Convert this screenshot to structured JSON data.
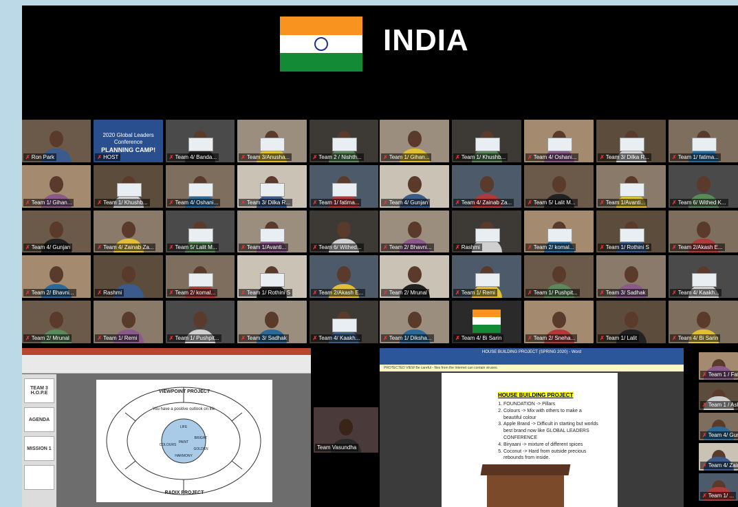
{
  "header": {
    "title": "INDIA"
  },
  "colors": {
    "saffron": "#f7931e",
    "green": "#138a36",
    "chakra": "#1c2f8a",
    "zoom_bg": "#000000"
  },
  "host_slide": {
    "line1": "2020 Global Leaders Conference",
    "line2": "PLANNING CAMP!"
  },
  "left_grid": [
    {
      "label": "Ron Park",
      "type": "person"
    },
    {
      "label": "HOST",
      "type": "host"
    },
    {
      "label": "Team 4/ Banda...",
      "type": "card"
    },
    {
      "label": "Team 3/Anusha...",
      "type": "card"
    },
    {
      "label": "Team 2 / Nishth...",
      "type": "card"
    },
    {
      "label": "Team 1/ Gihan...",
      "type": "person"
    },
    {
      "label": "Team 1/ Khushb...",
      "type": "card"
    },
    {
      "label": "Team 4/ Oshani...",
      "type": "card"
    },
    {
      "label": "Team 3/ Dilka R...",
      "type": "card"
    },
    {
      "label": "Team 1/ fatima...",
      "type": "card"
    },
    {
      "label": "Team 4/ Gunjan",
      "type": "person"
    },
    {
      "label": "Team 4/ Zainab Za...",
      "type": "person"
    },
    {
      "label": "Team 5/ Lalit M...",
      "type": "card"
    },
    {
      "label": "Team 1/Avanti...",
      "type": "card"
    },
    {
      "label": "Team 6/ Withed...",
      "type": "person"
    },
    {
      "label": "Team 2/ Bhavni...",
      "type": "person"
    },
    {
      "label": "Rashmi",
      "type": "person"
    },
    {
      "label": "Team 2/ komal...",
      "type": "card"
    },
    {
      "label": "Team 1/ Rothini S",
      "type": "card"
    },
    {
      "label": "Team 2/Akash E...",
      "type": "person"
    },
    {
      "label": "Team 2/ Mrunal",
      "type": "person"
    },
    {
      "label": "Team 1/ Remi",
      "type": "person"
    },
    {
      "label": "Team 1/ Pushpit...",
      "type": "person"
    },
    {
      "label": "Team 3/ Sadhak",
      "type": "person"
    },
    {
      "label": "Team 4/ Kaakh...",
      "type": "card"
    }
  ],
  "right_grid": [
    {
      "label": "Team 1/ Gihan...",
      "type": "person"
    },
    {
      "label": "Team 1/ Khushb...",
      "type": "card"
    },
    {
      "label": "Team 4/ Oshani...",
      "type": "card"
    },
    {
      "label": "Team 3/ Dilka R...",
      "type": "card"
    },
    {
      "label": "Team 1/ fatima...",
      "type": "card"
    },
    {
      "label": "Team 4/ Gunjan",
      "type": "person"
    },
    {
      "label": "Team 4/ Zainab Za...",
      "type": "person"
    },
    {
      "label": "Team 5/ Lalit M...",
      "type": "person"
    },
    {
      "label": "Team 1/Avanti...",
      "type": "card"
    },
    {
      "label": "Team 6/ Withed K...",
      "type": "person"
    },
    {
      "label": "Team 2/ Bhavni...",
      "type": "person"
    },
    {
      "label": "Rashmi",
      "type": "card"
    },
    {
      "label": "Team 2/ komal...",
      "type": "card"
    },
    {
      "label": "Team 1/ Rothini S",
      "type": "card"
    },
    {
      "label": "Team 2/Akash E...",
      "type": "person"
    },
    {
      "label": "Team 2/ Mrunal",
      "type": "person"
    },
    {
      "label": "Team 1/ Remi",
      "type": "card"
    },
    {
      "label": "Team 1/ Pushpit...",
      "type": "person"
    },
    {
      "label": "Team 3/ Sadhak",
      "type": "person"
    },
    {
      "label": "Team 4/ Kaakh...",
      "type": "card"
    },
    {
      "label": "Team 1/ Diksha...",
      "type": "person"
    },
    {
      "label": "Team 4/ Bi Sarin",
      "type": "flag"
    },
    {
      "label": "Team 2/ Sneha...",
      "type": "person"
    },
    {
      "label": "Team 1/ Lalit",
      "type": "person"
    },
    {
      "label": "Team 4/ Bi Sarin",
      "type": "person"
    }
  ],
  "single_tile": {
    "label": "Team Vasundha"
  },
  "right_col": [
    {
      "label": "Team 1 / Fatima..."
    },
    {
      "label": "Team 1 / Ashok..."
    },
    {
      "label": "Team 4/ Gunjan"
    },
    {
      "label": "Team 4/ Zainab Za..."
    },
    {
      "label": "Team 1/ ..."
    }
  ],
  "ppt": {
    "thumbs": [
      "TEAM 3 H.O.P.E",
      "AGENDA",
      "MISSION 1",
      ""
    ],
    "cap_top": "VIEWPOINT PROJECT",
    "cap_bot": "RADIX PROJECT",
    "wheel_center": "You have a positive outlook on life",
    "wheel_core": [
      "LIFE",
      "BRIGHT",
      "PAINT",
      "GOLDEN",
      "COLOURS",
      "HARMONY"
    ]
  },
  "word": {
    "title": "HOUSE BUILDING PROJECT (SPRING 2020) - Word",
    "protect": "PROTECTED VIEW  Be careful - files from the Internet can contain viruses.",
    "heading": "HOUSE BUILDING PROJECT",
    "items": [
      "FOUNDATION -> Pillars",
      "Colours -> Mix with others to make a beautiful colour",
      "Apple Brand -> Difficult in starting but worlds best brand now like GLOBAL LEADERS CONFERENCE",
      "Biryaani -> mixture of different spices",
      "Coconut -> Hard from outside precious rebounds from inside."
    ]
  }
}
